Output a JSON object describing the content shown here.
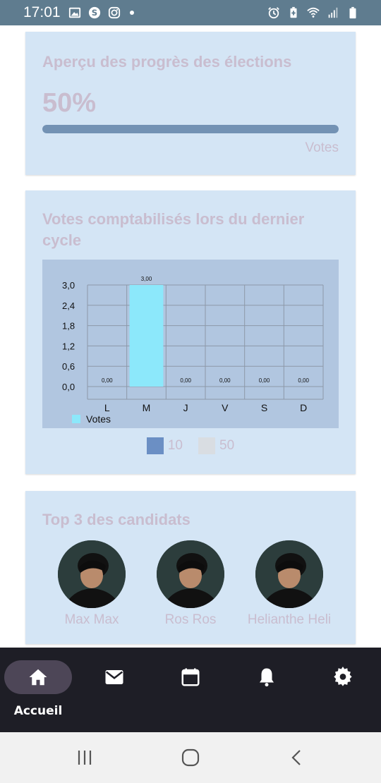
{
  "status_bar": {
    "time": "17:01",
    "left_icons": [
      "image-icon",
      "s-circle-icon",
      "instagram-icon",
      "dot-icon"
    ],
    "right_icons": [
      "alarm-icon",
      "battery-saver-icon",
      "wifi-icon",
      "signal-icon",
      "battery-icon"
    ]
  },
  "progress_card": {
    "title": "Aperçu des progrès des élections",
    "percent_text": "50%",
    "progress_value": 1.0,
    "caption": "Votes"
  },
  "chart_card": {
    "title": "Votes comptabilisés lors du dernier cycle",
    "legend": [
      {
        "label": "10",
        "color": "#6b8fc4"
      },
      {
        "label": "50",
        "color": "#d9dde2"
      }
    ]
  },
  "chart_data": {
    "type": "bar",
    "categories": [
      "L",
      "M",
      "J",
      "V",
      "S",
      "D"
    ],
    "series": [
      {
        "name": "Votes",
        "values": [
          0,
          3,
          0,
          0,
          0,
          0
        ],
        "color": "#8ce8fb"
      }
    ],
    "value_labels": [
      "0,00",
      "3,00",
      "0,00",
      "0,00",
      "0,00",
      "0,00"
    ],
    "y_ticks": [
      "0,0",
      "0,6",
      "1,2",
      "1,8",
      "2,4",
      "3,0"
    ],
    "ylim": [
      0,
      3
    ],
    "grid": true,
    "legend_position": "bottom-left",
    "title": "",
    "xlabel": "",
    "ylabel": ""
  },
  "candidates_card": {
    "title": "Top 3 des candidats",
    "candidates": [
      {
        "name": "Max Max"
      },
      {
        "name": "Ros Ros"
      },
      {
        "name": "Helianthe Heli"
      }
    ]
  },
  "bottom_nav": {
    "active_label": "Accueil",
    "items": [
      "home-icon",
      "mail-icon",
      "calendar-icon",
      "bell-icon",
      "gear-icon"
    ]
  },
  "colors": {
    "status_bar": "#5f7c8f",
    "card_bg": "#d4e5f5",
    "title_text": "#c9bdcf",
    "progress_fill": "#7392b4",
    "nav_bg": "#1e1e26",
    "nav_active": "#4d4657"
  }
}
